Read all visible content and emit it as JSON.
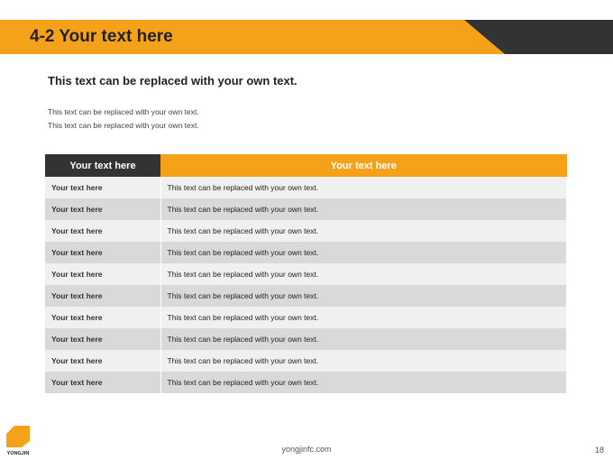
{
  "header": {
    "title": "4-2 Your text here"
  },
  "subtitle": "This text can be replaced with your own text.",
  "description": [
    "This text can be replaced with your own text.",
    "This text can be replaced with your own text."
  ],
  "table": {
    "headers": [
      "Your text here",
      "Your text here"
    ],
    "rows": [
      [
        "Your text here",
        "This text can be replaced with your own text."
      ],
      [
        "Your text here",
        "This text can be replaced with your own text."
      ],
      [
        "Your text here",
        "This text can be replaced with your own text."
      ],
      [
        "Your text here",
        "This text can be replaced with your own text."
      ],
      [
        "Your text here",
        "This text can be replaced with your own text."
      ],
      [
        "Your text here",
        "This text can be replaced with your own text."
      ],
      [
        "Your text here",
        "This text can be replaced with your own text."
      ],
      [
        "Your text here",
        "This text can be replaced with your own text."
      ],
      [
        "Your text here",
        "This text can be replaced with your own text."
      ],
      [
        "Your text here",
        "This text can be replaced with your own text."
      ]
    ]
  },
  "footer": {
    "logo_text": "YONGJIN",
    "url": "yongjinfc.com",
    "page_number": "18"
  },
  "colors": {
    "accent": "#f5a11a",
    "dark": "#333333",
    "row_light": "#f0f0f0",
    "row_dark": "#d9d9d9"
  }
}
